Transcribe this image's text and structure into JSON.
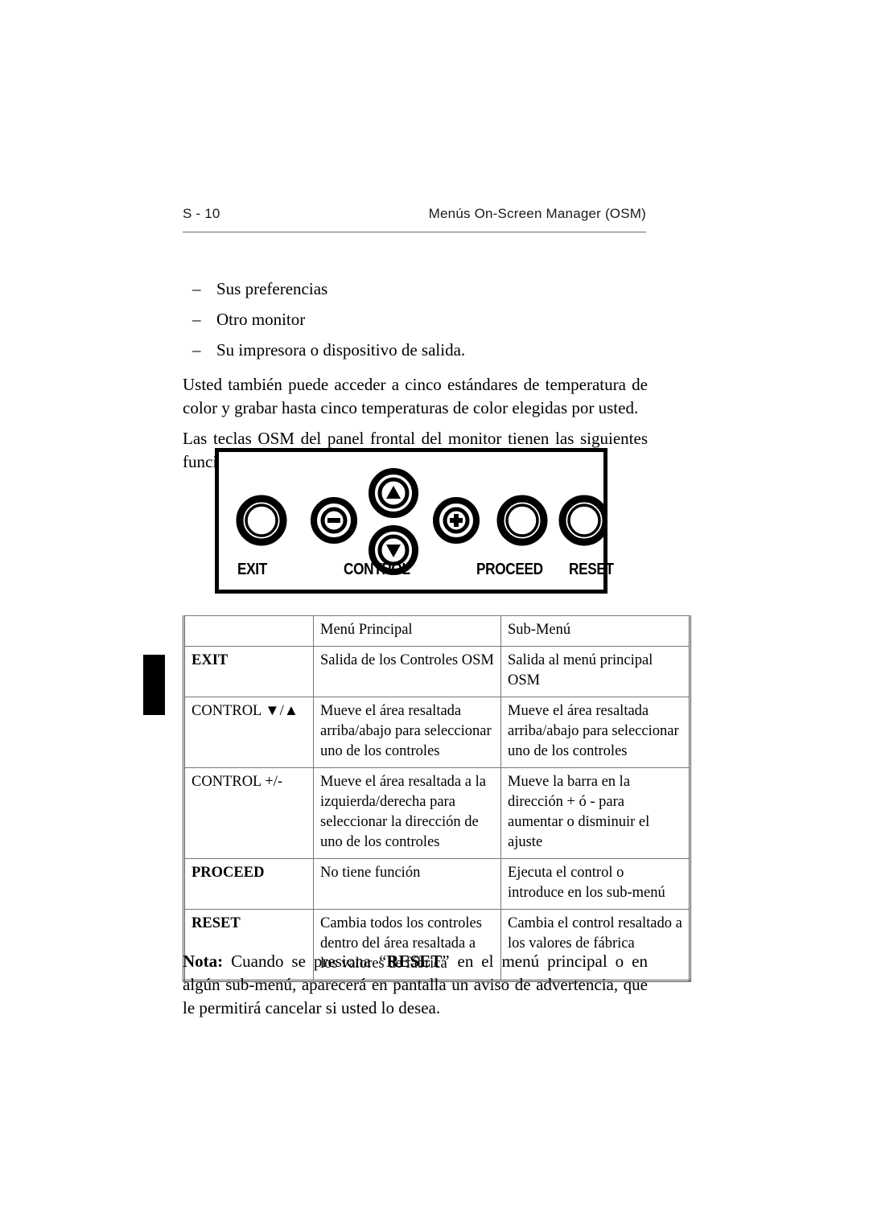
{
  "header": {
    "page_number": "S - 10",
    "title": "Menús On-Screen Manager (OSM)"
  },
  "bullets": [
    {
      "dash": "–",
      "text": "Sus preferencias"
    },
    {
      "dash": "–",
      "text": "Otro monitor"
    },
    {
      "dash": "–",
      "text": "Su impresora o dispositivo de salida."
    }
  ],
  "paragraphs": [
    "Usted también puede acceder a cinco estándares de temperatura de color y grabar hasta cinco temperaturas de color elegidas por usted.",
    "Las teclas OSM del panel frontal del monitor tienen las siguientes funciones:"
  ],
  "panel": {
    "labels": {
      "exit": "EXIT",
      "control": "CONTROL",
      "proceed": "PROCEED",
      "reset": "RESET"
    },
    "buttons": [
      {
        "name": "exit-button",
        "glyph": "none"
      },
      {
        "name": "minus-button",
        "glyph": "minus"
      },
      {
        "name": "up-button",
        "glyph": "triangle-up"
      },
      {
        "name": "down-button",
        "glyph": "triangle-down"
      },
      {
        "name": "plus-button",
        "glyph": "plus"
      },
      {
        "name": "proceed-button",
        "glyph": "none"
      },
      {
        "name": "reset-button",
        "glyph": "none"
      }
    ]
  },
  "table": {
    "headers": [
      "",
      "Menú Principal",
      "Sub-Menú"
    ],
    "rows": [
      {
        "key": "EXIT",
        "key_bold": true,
        "main": "Salida de los Controles OSM",
        "sub": "Salida al menú principal OSM"
      },
      {
        "key": "CONTROL ▼/▲",
        "key_bold": false,
        "main": "Mueve el área resaltada arriba/abajo para seleccionar uno de los controles",
        "sub": "Mueve el área resaltada arriba/abajo para seleccionar uno de los controles"
      },
      {
        "key": "CONTROL +/-",
        "key_bold": false,
        "main": "Mueve el área resaltada a la izquierda/derecha para seleccionar la dirección de uno de los controles",
        "sub": "Mueve la barra en la dirección + ó - para aumentar o disminuir el ajuste"
      },
      {
        "key": "PROCEED",
        "key_bold": true,
        "main": "No tiene función",
        "sub": "Ejecuta el control o introduce en los sub-menú"
      },
      {
        "key": "RESET",
        "key_bold": true,
        "main": "Cambia todos los controles dentro del área resaltada a los valores de fábrica",
        "sub": "Cambia el control resaltado a los valores de fábrica"
      }
    ]
  },
  "note": {
    "label": "Nota:",
    "text_before": " Cuando se presiona “",
    "emphasis": "RESET",
    "text_after": "” en el menú principal o en algún sub-menú, aparecerá en pantalla un aviso de advertencia, que le permitirá cancelar si usted lo desea."
  }
}
